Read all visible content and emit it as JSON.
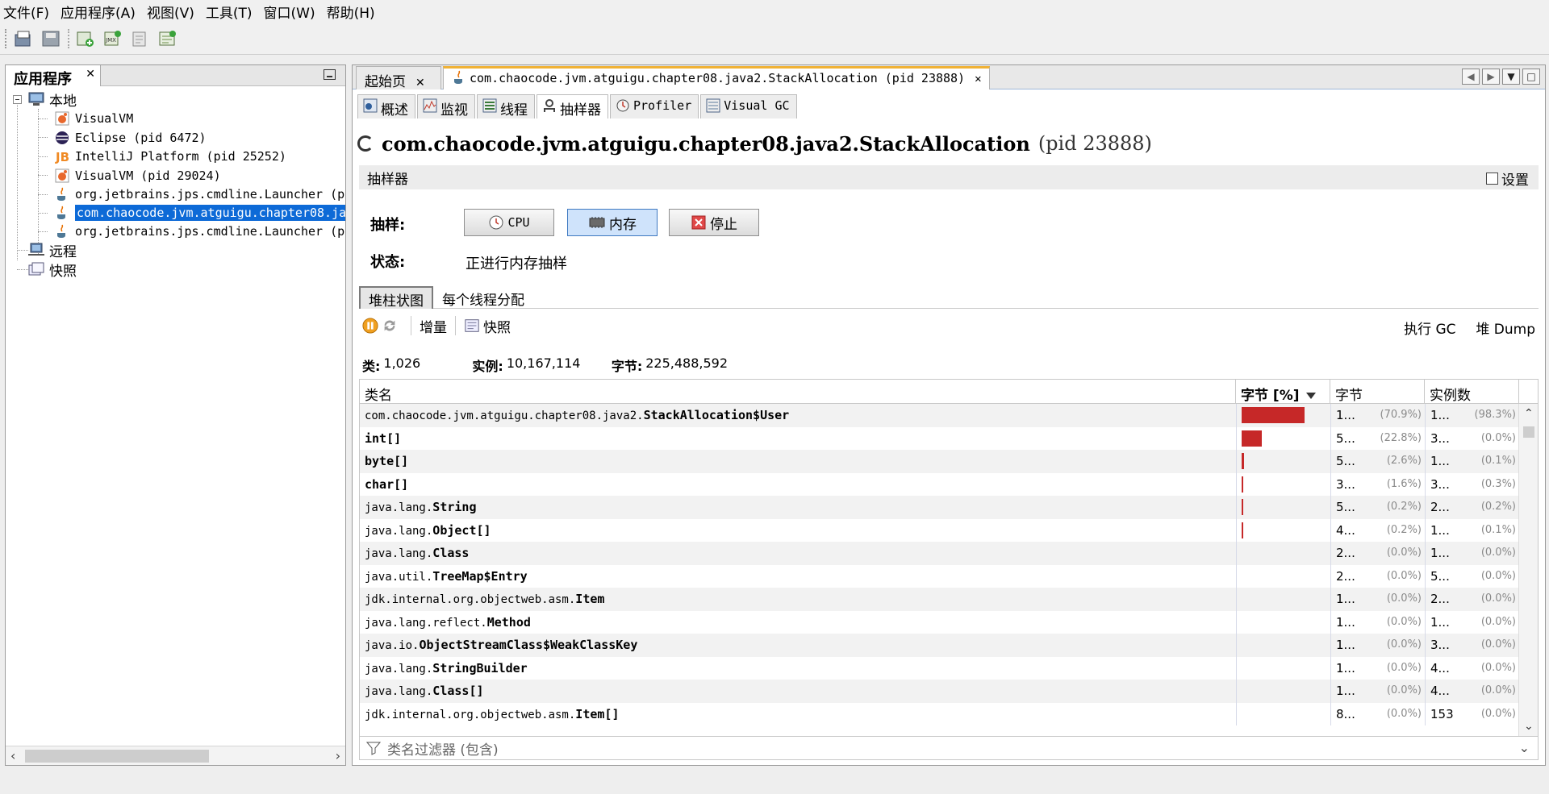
{
  "menu": [
    "文件(F)",
    "应用程序(A)",
    "视图(V)",
    "工具(T)",
    "窗口(W)",
    "帮助(H)"
  ],
  "left_panel": {
    "tab_label": "应用程序",
    "tree": {
      "local": "本地",
      "children": [
        "VisualVM",
        "Eclipse (pid 6472)",
        "IntelliJ Platform (pid 25252)",
        "VisualVM (pid 29024)",
        "org.jetbrains.jps.cmdline.Launcher (p",
        "com.chaocode.jvm.atguigu.chapter08.ja",
        "org.jetbrains.jps.cmdline.Launcher (p"
      ],
      "remote": "远程",
      "snapshots": "快照"
    }
  },
  "doc_tabs": [
    {
      "label": "起始页"
    },
    {
      "label": "com.chaocode.jvm.atguigu.chapter08.java2.StackAllocation (pid 23888)"
    }
  ],
  "view_tabs": [
    "概述",
    "监视",
    "线程",
    "抽样器",
    "Profiler",
    "Visual GC"
  ],
  "page": {
    "title": "com.chaocode.jvm.atguigu.chapter08.java2.StackAllocation",
    "pid": "(pid 23888)"
  },
  "sampler": {
    "section_label": "抽样器",
    "settings_label": "设置",
    "sample_label": "抽样:",
    "status_label": "状态:",
    "status_text": "正进行内存抽样",
    "buttons": {
      "cpu": "CPU",
      "memory": "内存",
      "stop": "停止"
    }
  },
  "sub_tabs": [
    "堆柱状图",
    "每个线程分配"
  ],
  "mini_toolbar": {
    "delta": "增量",
    "snapshot": "快照",
    "gc": "执行 GC",
    "heap_dump": "堆 Dump"
  },
  "summary": {
    "classes_label": "类:",
    "classes": "1,026",
    "instances_label": "实例:",
    "instances": "10,167,114",
    "bytes_label": "字节:",
    "bytes": "225,488,592"
  },
  "table": {
    "headers": {
      "name": "类名",
      "bytes_pct": "字节 [%]",
      "bytes": "字节",
      "instances": "实例数"
    },
    "rows": [
      {
        "pkg": "com.chaocode.jvm.atguigu.chapter08.java2.",
        "cls": "StackAllocation$User",
        "bar": 0.709,
        "bytes": "1...",
        "bytes_pct": "(70.9%)",
        "inst": "1...",
        "inst_pct": "(98.3%)"
      },
      {
        "pkg": "",
        "cls": "int[]",
        "bar": 0.228,
        "bytes": "5...",
        "bytes_pct": "(22.8%)",
        "inst": "3...",
        "inst_pct": "(0.0%)"
      },
      {
        "pkg": "",
        "cls": "byte[]",
        "bar": 0.026,
        "bytes": "5...",
        "bytes_pct": "(2.6%)",
        "inst": "1...",
        "inst_pct": "(0.1%)"
      },
      {
        "pkg": "",
        "cls": "char[]",
        "bar": 0.016,
        "bytes": "3...",
        "bytes_pct": "(1.6%)",
        "inst": "3...",
        "inst_pct": "(0.3%)"
      },
      {
        "pkg": "java.lang.",
        "cls": "String",
        "bar": 0.002,
        "bytes": "5...",
        "bytes_pct": "(0.2%)",
        "inst": "2...",
        "inst_pct": "(0.2%)"
      },
      {
        "pkg": "java.lang.",
        "cls": "Object[]",
        "bar": 0.002,
        "bytes": "4...",
        "bytes_pct": "(0.2%)",
        "inst": "1...",
        "inst_pct": "(0.1%)"
      },
      {
        "pkg": "java.lang.",
        "cls": "Class",
        "bar": 0,
        "bytes": "2...",
        "bytes_pct": "(0.0%)",
        "inst": "1...",
        "inst_pct": "(0.0%)"
      },
      {
        "pkg": "java.util.",
        "cls": "TreeMap$Entry",
        "bar": 0,
        "bytes": "2...",
        "bytes_pct": "(0.0%)",
        "inst": "5...",
        "inst_pct": "(0.0%)"
      },
      {
        "pkg": "jdk.internal.org.objectweb.asm.",
        "cls": "Item",
        "bar": 0,
        "bytes": "1...",
        "bytes_pct": "(0.0%)",
        "inst": "2...",
        "inst_pct": "(0.0%)"
      },
      {
        "pkg": "java.lang.reflect.",
        "cls": "Method",
        "bar": 0,
        "bytes": "1...",
        "bytes_pct": "(0.0%)",
        "inst": "1...",
        "inst_pct": "(0.0%)"
      },
      {
        "pkg": "java.io.",
        "cls": "ObjectStreamClass$WeakClassKey",
        "bar": 0,
        "bytes": "1...",
        "bytes_pct": "(0.0%)",
        "inst": "3...",
        "inst_pct": "(0.0%)"
      },
      {
        "pkg": "java.lang.",
        "cls": "StringBuilder",
        "bar": 0,
        "bytes": "1...",
        "bytes_pct": "(0.0%)",
        "inst": "4...",
        "inst_pct": "(0.0%)"
      },
      {
        "pkg": "java.lang.",
        "cls": "Class[]",
        "bar": 0,
        "bytes": "1...",
        "bytes_pct": "(0.0%)",
        "inst": "4...",
        "inst_pct": "(0.0%)"
      },
      {
        "pkg": "jdk.internal.org.objectweb.asm.",
        "cls": "Item[]",
        "bar": 0,
        "bytes": "8...",
        "bytes_pct": "(0.0%)",
        "inst": "153",
        "inst_pct": "(0.0%)"
      }
    ]
  },
  "filter_placeholder": "类名过滤器 (包含)",
  "colors": {
    "selection": "#0d6ad7",
    "bar": "#c62828",
    "active_tab_accent": "#f0b236"
  }
}
